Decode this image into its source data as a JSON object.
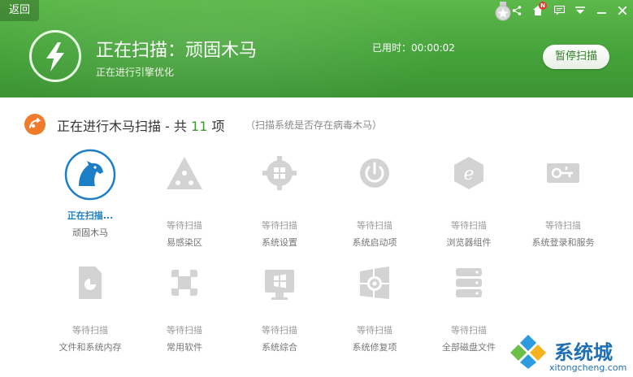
{
  "header": {
    "back_label": "返回",
    "scan_title": "正在扫描：顽固木马",
    "scan_subtitle": "正在进行引擎优化",
    "elapsed": "已用时：00:00:02",
    "pause_label": "暂停扫描",
    "badge_text": "N"
  },
  "section": {
    "title_prefix": "正在进行木马扫描 - 共 ",
    "count": "11",
    "title_suffix": " 项",
    "note": "（扫描系统是否存在病毒木马）"
  },
  "items": [
    {
      "status": "正在扫描...",
      "label": "顽固木马",
      "icon": "horse-icon"
    },
    {
      "status": "等待扫描",
      "label": "易感染区",
      "icon": "warning-triangle-icon"
    },
    {
      "status": "等待扫描",
      "label": "系统设置",
      "icon": "gear-windows-icon"
    },
    {
      "status": "等待扫描",
      "label": "系统启动项",
      "icon": "power-icon"
    },
    {
      "status": "等待扫描",
      "label": "浏览器组件",
      "icon": "ie-browser-icon"
    },
    {
      "status": "等待扫描",
      "label": "系统登录和服务",
      "icon": "key-login-icon"
    },
    {
      "status": "等待扫描",
      "label": "文件和系统内存",
      "icon": "file-memory-icon"
    },
    {
      "status": "等待扫描",
      "label": "常用软件",
      "icon": "software-grid-icon"
    },
    {
      "status": "等待扫描",
      "label": "系统综合",
      "icon": "monitor-windows-icon"
    },
    {
      "status": "等待扫描",
      "label": "系统修复项",
      "icon": "windows-repair-icon"
    },
    {
      "status": "等待扫描",
      "label": "全部磁盘文件",
      "icon": "disk-stack-icon"
    }
  ],
  "watermark": {
    "brand": "系统城",
    "url": "xitongcheng.com"
  },
  "colors": {
    "header_green": "#45a33a",
    "active_blue": "#1c7fc6",
    "count_green": "#3c9b2f",
    "section_icon_orange": "#f07b2a"
  }
}
